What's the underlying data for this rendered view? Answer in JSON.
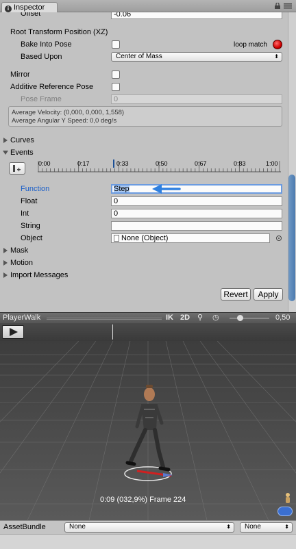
{
  "window": {
    "tab_title": "Inspector"
  },
  "inspector": {
    "offset_label": "Offset",
    "offset_value": "-0.06",
    "root_position_header": "Root Transform Position (XZ)",
    "bake_label": "Bake Into Pose",
    "loop_match": "loop match",
    "based_upon_label": "Based Upon",
    "based_upon_value": "Center of Mass",
    "mirror_label": "Mirror",
    "additive_label": "Additive Reference Pose",
    "pose_frame_label": "Pose Frame",
    "pose_frame_value": "0",
    "info_velocity": "Average Velocity: (0,000, 0,000, 1,558)",
    "info_angular": "Average Angular Y Speed: 0,0 deg/s",
    "curves": "Curves",
    "events": "Events",
    "timeline_ticks": [
      "0:00",
      "0:17",
      "0:33",
      "0:50",
      "0:67",
      "0:83",
      "1:00"
    ],
    "function_label": "Function",
    "function_value": "Step",
    "float_label": "Float",
    "float_value": "0",
    "int_label": "Int",
    "int_value": "0",
    "string_label": "String",
    "string_value": "",
    "object_label": "Object",
    "object_value": "None (Object)",
    "mask": "Mask",
    "motion": "Motion",
    "import_messages": "Import Messages",
    "revert": "Revert",
    "apply": "Apply"
  },
  "preview": {
    "title": "PlayerWalk",
    "ik": "IK",
    "mode2d": "2D",
    "speed": "0,50",
    "status": "0:09 (032,9%) Frame 224"
  },
  "assetbundle": {
    "label": "AssetBundle",
    "name_value": "None",
    "variant_value": "None"
  },
  "colors": {
    "accent": "#1b5fc9",
    "arrow": "#2f80e0",
    "loop_dot": "#e00000"
  }
}
